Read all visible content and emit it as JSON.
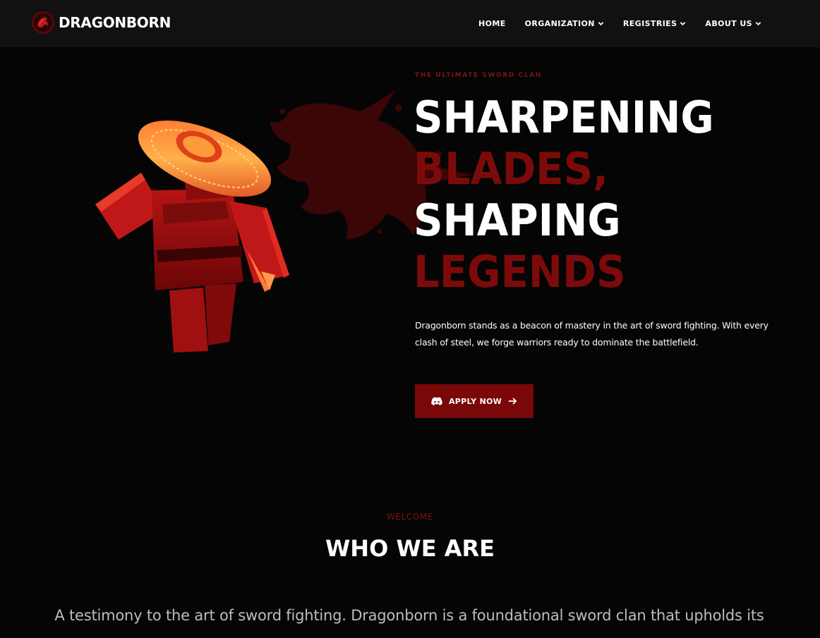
{
  "header": {
    "brand_name": "DRAGONBORN",
    "nav": [
      {
        "label": "HOME",
        "has_dropdown": false
      },
      {
        "label": "ORGANIZATION",
        "has_dropdown": true
      },
      {
        "label": "REGISTRIES",
        "has_dropdown": true
      },
      {
        "label": "ABOUT US",
        "has_dropdown": true
      }
    ]
  },
  "hero": {
    "eyebrow": "THE ULTIMATE SWORD CLAN",
    "headline": {
      "line1": "SHARPENING",
      "line2": "BLADES,",
      "line3": "SHAPING",
      "line4": "LEGENDS"
    },
    "description": "Dragonborn stands as a beacon of mastery in the art of sword fighting. With every clash of steel, we forge warriors ready to dominate the battlefield.",
    "cta_label": "APPLY NOW"
  },
  "about": {
    "eyebrow": "WELCOME",
    "title": "WHO WE ARE",
    "text": "A testimony to the art of sword fighting. Dragonborn is a foundational sword clan that upholds its"
  },
  "icons": {
    "brand": "dragon-logo-icon",
    "dropdown": "chevron-down-icon",
    "cta_left": "discord-icon",
    "cta_right": "arrow-right-icon"
  },
  "colors": {
    "accent": "#7a0808",
    "accent_text": "#7d0a0a",
    "background": "#050505",
    "header": "#111111"
  }
}
